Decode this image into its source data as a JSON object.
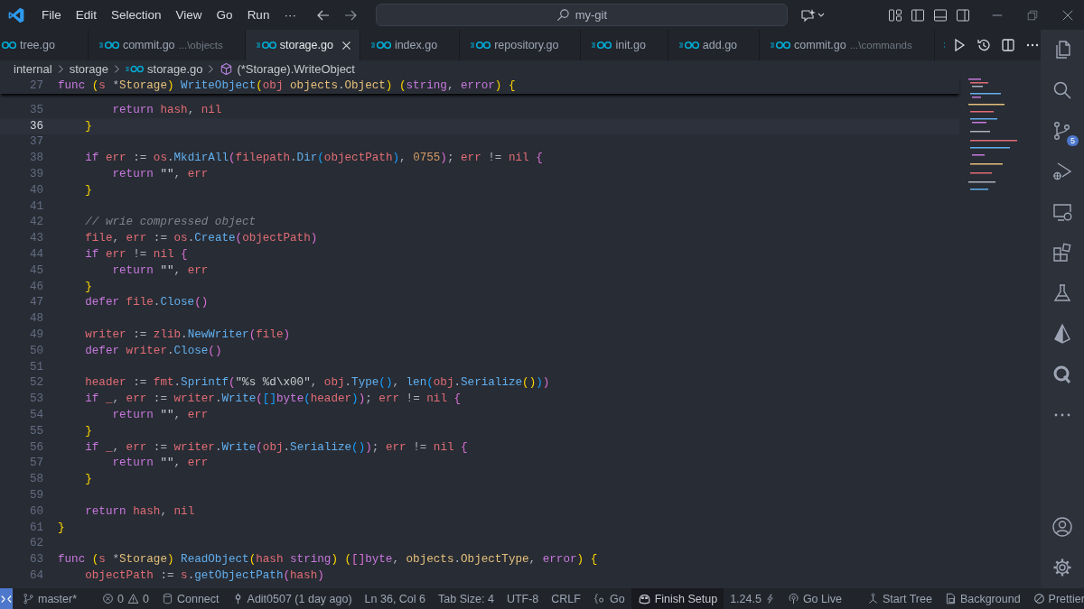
{
  "title_bar": {
    "menu": [
      "File",
      "Edit",
      "Selection",
      "View",
      "Go",
      "Run"
    ],
    "menu_more": "···",
    "search": "my-git"
  },
  "tabs": [
    {
      "label": "tree.go",
      "selected": false
    },
    {
      "label": "commit.go",
      "description": "...\\objects",
      "selected": false
    },
    {
      "label": "storage.go",
      "selected": true
    },
    {
      "label": "index.go",
      "selected": false
    },
    {
      "label": "repository.go",
      "selected": false
    },
    {
      "label": "init.go",
      "selected": false
    },
    {
      "label": "add.go",
      "selected": false
    },
    {
      "label": "commit.go",
      "description": "...\\commands",
      "selected": false
    }
  ],
  "breadcrumbs": [
    {
      "label": "internal",
      "kind": "folder"
    },
    {
      "label": "storage",
      "kind": "folder"
    },
    {
      "label": "storage.go",
      "kind": "file"
    },
    {
      "label": "(*Storage).WriteObject",
      "kind": "method"
    }
  ],
  "editor": {
    "sticky_line": {
      "number": "27",
      "text": "func (s *Storage) WriteObject(obj objects.Object) (string, error) {"
    },
    "lines": [
      {
        "number": "35",
        "current": false,
        "text": "        return hash, nil"
      },
      {
        "number": "36",
        "current": true,
        "text": "    }"
      },
      {
        "number": "37",
        "current": false
      },
      {
        "number": "38",
        "current": false,
        "text": "    if err := os.MkdirAll(filepath.Dir(objectPath), 0755); err != nil {"
      },
      {
        "number": "39",
        "current": false,
        "text": "        return \"\", err"
      },
      {
        "number": "40",
        "current": false,
        "text": "    }"
      },
      {
        "number": "41",
        "current": false
      },
      {
        "number": "42",
        "current": false,
        "text": "    // wrie compressed object"
      },
      {
        "number": "43",
        "current": false,
        "text": "    file, err := os.Create(objectPath)"
      },
      {
        "number": "44",
        "current": false,
        "text": "    if err != nil {"
      },
      {
        "number": "45",
        "current": false,
        "text": "        return \"\", err"
      },
      {
        "number": "46",
        "current": false,
        "text": "    }"
      },
      {
        "number": "47",
        "current": false,
        "text": "    defer file.Close()"
      },
      {
        "number": "48",
        "current": false
      },
      {
        "number": "49",
        "current": false,
        "text": "    writer := zlib.NewWriter(file)"
      },
      {
        "number": "50",
        "current": false,
        "text": "    defer writer.Close()"
      },
      {
        "number": "51",
        "current": false
      },
      {
        "number": "52",
        "current": false,
        "text": "    header := fmt.Sprintf(\"%s %d\\x00\", obj.Type(), len(obj.Serialize()))"
      },
      {
        "number": "53",
        "current": false,
        "text": "    if _, err := writer.Write([]byte(header)); err != nil {"
      },
      {
        "number": "54",
        "current": false,
        "text": "        return \"\", err"
      },
      {
        "number": "55",
        "current": false,
        "text": "    }"
      },
      {
        "number": "56",
        "current": false,
        "text": "    if _, err := writer.Write(obj.Serialize()); err != nil {"
      },
      {
        "number": "57",
        "current": false,
        "text": "        return \"\", err"
      },
      {
        "number": "58",
        "current": false,
        "text": "    }"
      },
      {
        "number": "59",
        "current": false
      },
      {
        "number": "60",
        "current": false,
        "text": "    return hash, nil"
      },
      {
        "number": "61",
        "current": false,
        "text": "}"
      },
      {
        "number": "62",
        "current": false
      },
      {
        "number": "63",
        "current": false,
        "text": "func (s *Storage) ReadObject(hash string) ([]byte, objects.ObjectType, error) {"
      },
      {
        "number": "64",
        "current": false,
        "text": "    objectPath := s.getObjectPath(hash)"
      }
    ]
  },
  "activity_bar": {
    "source_control_badge": "5"
  },
  "status_bar": [
    {
      "kind": "branch",
      "label": "master*"
    },
    {
      "kind": "sync"
    },
    {
      "kind": "problems",
      "errors": "0",
      "warnings": "0"
    },
    {
      "kind": "database",
      "label": "Connect"
    },
    {
      "kind": "spacer"
    },
    {
      "kind": "blame",
      "label": "Adit0507 (1 day ago)"
    },
    {
      "kind": "text",
      "label": "Ln 36, Col 6"
    },
    {
      "kind": "text",
      "label": "Tab Size: 4"
    },
    {
      "kind": "text",
      "label": "UTF-8"
    },
    {
      "kind": "text",
      "label": "CRLF"
    },
    {
      "kind": "language",
      "label": "Go"
    },
    {
      "kind": "copilot",
      "label": "Finish Setup"
    },
    {
      "kind": "version",
      "label": "1.24.5"
    },
    {
      "kind": "live",
      "label": "Go Live"
    },
    {
      "kind": "squirrel"
    },
    {
      "kind": "tree",
      "label": "Start Tree"
    },
    {
      "kind": "background",
      "label": "Background"
    },
    {
      "kind": "prettier",
      "label": "Prettier"
    },
    {
      "kind": "bell"
    }
  ]
}
